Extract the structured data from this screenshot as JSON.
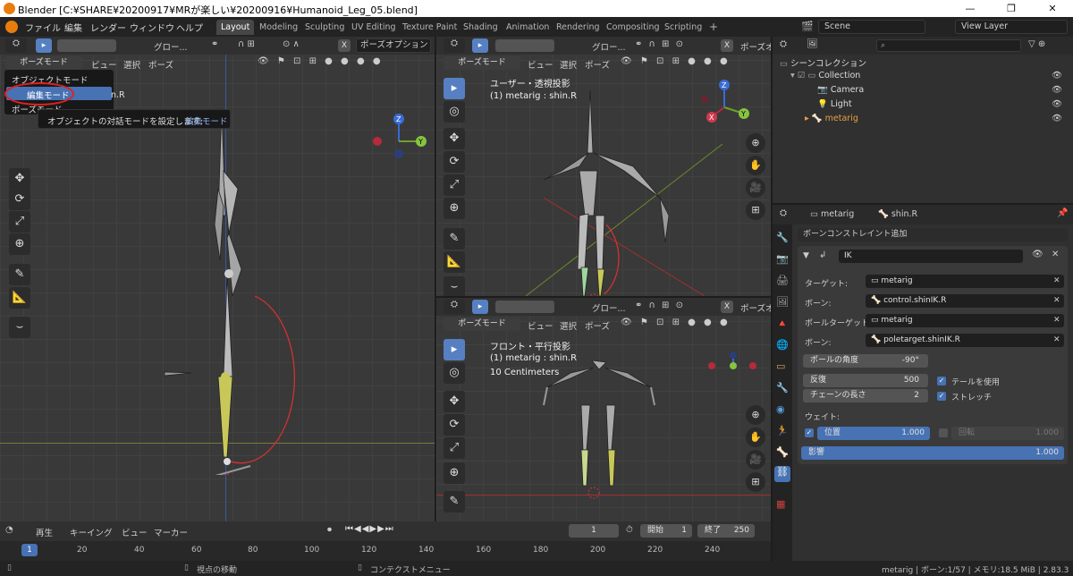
{
  "window": {
    "title": "Blender [C:¥SHARE¥20200917¥MRが楽しい¥20200916¥Humanoid_Leg_05.blend]",
    "min": "—",
    "max": "❐",
    "close": "✕"
  },
  "menubar": {
    "items": [
      "ファイル",
      "編集",
      "レンダー",
      "ウィンドウ",
      "ヘルプ"
    ]
  },
  "workspaces": {
    "tabs": [
      "Layout",
      "Modeling",
      "Sculpting",
      "UV Editing",
      "Texture Paint",
      "Shading",
      "Animation",
      "Rendering",
      "Compositing",
      "Scripting"
    ],
    "active": "Layout",
    "add": "+"
  },
  "scene": {
    "label": "Scene",
    "view_layer": "View Layer"
  },
  "left_viewport": {
    "header": {
      "transform": "グロー...",
      "pose_options": "ポーズオプション",
      "x_label": "X"
    },
    "subheader": {
      "mode": "ポーズモード",
      "view": "ビュー",
      "select": "選択",
      "pose": "ポーズ"
    },
    "mode_menu": {
      "items": [
        "オブジェクトモード",
        "編集モード",
        "ポーズモード"
      ],
      "highlighted": "編集モード",
      "tooltip_text": "オブジェクトの対話モードを設定します: ",
      "tooltip_value": "編集モード",
      "partial_overlay": "n.R"
    }
  },
  "right_top_viewport": {
    "header": {
      "transform": "グロー...",
      "pose_options": "ポーズオ",
      "x_label": "X"
    },
    "subheader": {
      "mode": "ポーズモード",
      "view": "ビュー",
      "select": "選択",
      "pose": "ポーズ"
    },
    "overlay": [
      "ユーザー・透視投影",
      "(1) metarig : shin.R"
    ]
  },
  "right_bottom_viewport": {
    "header": {
      "transform": "グロー...",
      "pose_options": "ポーズオ",
      "x_label": "X"
    },
    "subheader": {
      "mode": "ポーズモード",
      "view": "ビュー",
      "select": "選択",
      "pose": "ポーズ"
    },
    "overlay": [
      "フロント・平行投影",
      "(1) metarig : shin.R",
      "10 Centimeters"
    ]
  },
  "gizmo": {
    "x": "X",
    "y": "Y",
    "z": "Z"
  },
  "outliner": {
    "root": "シーンコレクション",
    "items": [
      {
        "label": "Collection",
        "icon": "collection-icon"
      },
      {
        "label": "Camera",
        "icon": "camera-icon"
      },
      {
        "label": "Light",
        "icon": "light-icon"
      },
      {
        "label": "metarig",
        "icon": "armature-icon"
      }
    ]
  },
  "properties": {
    "breadcrumb": {
      "object": "metarig",
      "bone": "shin.R"
    },
    "add_constraint": "ボーンコンストレイント追加",
    "constraint_name": "IK",
    "fields": [
      {
        "label": "ターゲット:",
        "value": "metarig"
      },
      {
        "label": "ボーン:",
        "value": "control.shinIK.R"
      },
      {
        "label": "ポールターゲット:",
        "value": "metarig"
      },
      {
        "label": "ボーン:",
        "value": "poletarget.shinIK.R"
      }
    ],
    "pole_angle": {
      "label": "ポールの角度",
      "value": "-90°"
    },
    "iterations": {
      "label": "反復",
      "value": "500"
    },
    "chain_length": {
      "label": "チェーンの長さ",
      "value": "2"
    },
    "use_tail": "テールを使用",
    "stretch": "ストレッチ",
    "weight_label": "ウェイト:",
    "position": {
      "label": "位置",
      "value": "1.000"
    },
    "rotation": {
      "label": "回転",
      "value": "1.000"
    },
    "influence": {
      "label": "影響",
      "value": "1.000"
    }
  },
  "timeline": {
    "menus": [
      "再生",
      "キーイング",
      "ビュー",
      "マーカー"
    ],
    "current_frame": "1",
    "start_label": "開始",
    "start": "1",
    "end_label": "終了",
    "end": "250",
    "ruler": [
      "1",
      "20",
      "40",
      "60",
      "80",
      "100",
      "120",
      "140",
      "160",
      "180",
      "200",
      "220",
      "240"
    ]
  },
  "statusbar": {
    "left": "視点の移動",
    "middle": "コンテクストメニュー",
    "right": "metarig | ボーン:1/57 | メモリ:18.5 MiB | 2.83.3"
  },
  "colors": {
    "accent": "#4772b3",
    "bone_selected": "#c8c85a",
    "ik_arc": "#e03030",
    "highlight_circle": "#e02020"
  }
}
